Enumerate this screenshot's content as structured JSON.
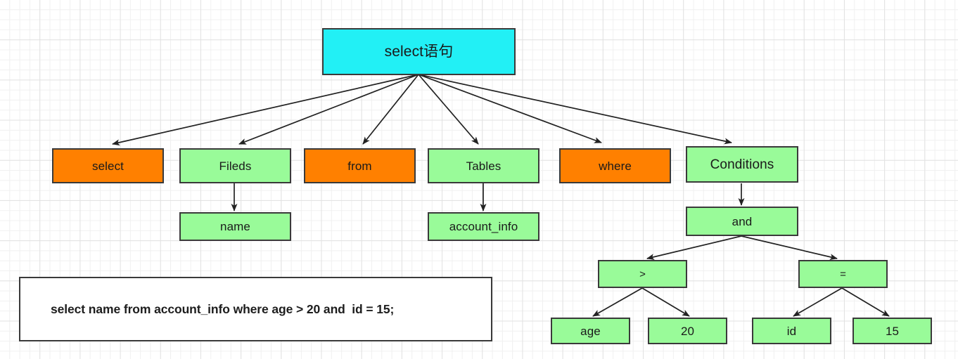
{
  "diagram": {
    "title": "select语句",
    "colors": {
      "root_fill": "#22f0f5",
      "keyword_fill": "#ff8000",
      "value_fill": "#99fb99",
      "border": "#3a3a3a",
      "grid_minor": "#f0f0f0",
      "grid_major": "#e2e2e2",
      "sqlbox_fill": "#ffffff"
    },
    "nodes": {
      "root": {
        "label": "select语句"
      },
      "level2": [
        {
          "label": "select",
          "kind": "keyword"
        },
        {
          "label": "Fileds",
          "kind": "value"
        },
        {
          "label": "from",
          "kind": "keyword"
        },
        {
          "label": "Tables",
          "kind": "value"
        },
        {
          "label": "where",
          "kind": "keyword"
        },
        {
          "label": "Conditions",
          "kind": "value"
        }
      ],
      "level3": [
        {
          "label": "name",
          "kind": "value"
        },
        {
          "label": "account_info",
          "kind": "value"
        },
        {
          "label": "and",
          "kind": "value"
        }
      ],
      "level4": [
        {
          "label": ">",
          "kind": "value"
        },
        {
          "label": "=",
          "kind": "value"
        }
      ],
      "level5": [
        {
          "label": "age",
          "kind": "value"
        },
        {
          "label": "20",
          "kind": "value"
        },
        {
          "label": "id",
          "kind": "value"
        },
        {
          "label": "15",
          "kind": "value"
        }
      ]
    },
    "sql_statement": "select name from account_info where age > 20 and  id = 15;"
  }
}
